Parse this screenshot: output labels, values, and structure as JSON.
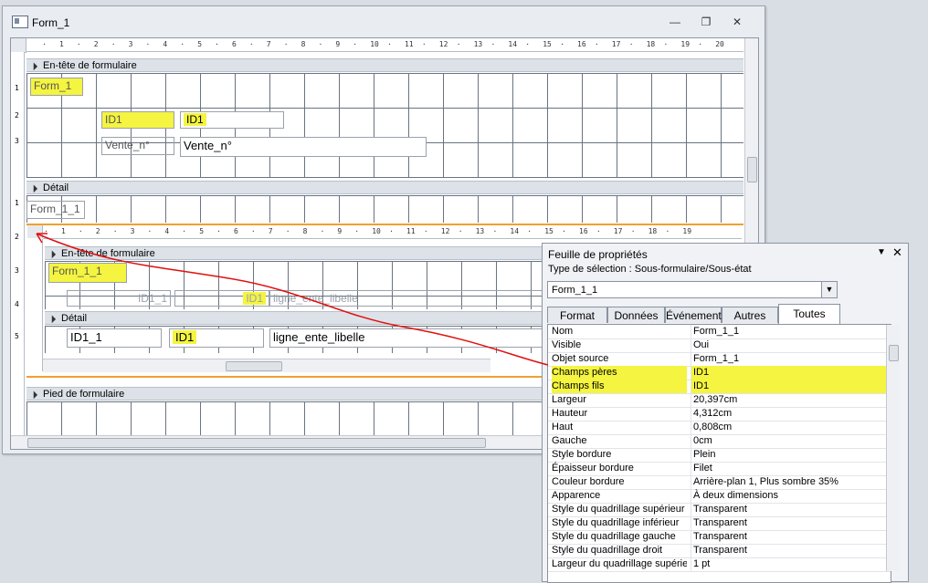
{
  "window": {
    "title": "Form_1",
    "minimize": "—",
    "restore": "❐",
    "close": "✕"
  },
  "ruler_main": [
    "1",
    "2",
    "3",
    "4",
    "5",
    "6",
    "7",
    "8",
    "9",
    "10",
    "11",
    "12",
    "13",
    "14",
    "15",
    "16",
    "17",
    "18",
    "19",
    "20"
  ],
  "ruler_sub": [
    "1",
    "2",
    "3",
    "4",
    "5",
    "6",
    "7",
    "8",
    "9",
    "10",
    "11",
    "12",
    "13",
    "14",
    "15",
    "16",
    "17",
    "18",
    "19"
  ],
  "ruler_v": [
    "1",
    "2",
    "3",
    "1",
    "2",
    "3",
    "4",
    "5"
  ],
  "sections": {
    "header": "En-tête de formulaire",
    "detail": "Détail",
    "footer": "Pied de formulaire"
  },
  "main_controls": {
    "form_label": "Form_1",
    "id1_label": "ID1",
    "id1_field": "ID1",
    "vente_label": "Vente_n°",
    "vente_field": "Vente_n°",
    "subform_label": "Form_1_1"
  },
  "subform": {
    "header": "En-tête de formulaire",
    "detail": "Détail",
    "form_label": "Form_1_1",
    "header_id1_label": "ID1_1",
    "header_id1_highlight": "ID1",
    "header_libelle": "ligne_ente_libelle",
    "detail_id1_label": "ID1_1",
    "detail_id1_field": "ID1",
    "detail_libelle": "ligne_ente_libelle"
  },
  "properties": {
    "title": "Feuille de propriétés",
    "selection_type": "Type de sélection :  Sous-formulaire/Sous-état",
    "combo_value": "Form_1_1",
    "tabs": [
      "Format",
      "Données",
      "Événement",
      "Autres",
      "Toutes"
    ],
    "active_tab": "Toutes",
    "rows": [
      {
        "name": "Nom",
        "value": "Form_1_1"
      },
      {
        "name": "Visible",
        "value": "Oui"
      },
      {
        "name": "Objet source",
        "value": "Form_1_1"
      },
      {
        "name": "Champs pères",
        "value": "ID1"
      },
      {
        "name": "Champs fils",
        "value": "ID1"
      },
      {
        "name": "Largeur",
        "value": "20,397cm"
      },
      {
        "name": "Hauteur",
        "value": "4,312cm"
      },
      {
        "name": "Haut",
        "value": "0,808cm"
      },
      {
        "name": "Gauche",
        "value": "0cm"
      },
      {
        "name": "Style bordure",
        "value": "Plein"
      },
      {
        "name": "Épaisseur bordure",
        "value": "Filet"
      },
      {
        "name": "Couleur bordure",
        "value": "Arrière-plan 1, Plus sombre 35%"
      },
      {
        "name": "Apparence",
        "value": "À deux dimensions"
      },
      {
        "name": "Style du quadrillage supérieur",
        "value": "Transparent"
      },
      {
        "name": "Style du quadrillage inférieur",
        "value": "Transparent"
      },
      {
        "name": "Style du quadrillage gauche",
        "value": "Transparent"
      },
      {
        "name": "Style du quadrillage droit",
        "value": "Transparent"
      },
      {
        "name": "Largeur du quadrillage supérieur",
        "value": "1 pt"
      }
    ]
  },
  "colors": {
    "highlight": "#f4f441",
    "arrow": "#e01010",
    "selection": "#f0a030"
  }
}
